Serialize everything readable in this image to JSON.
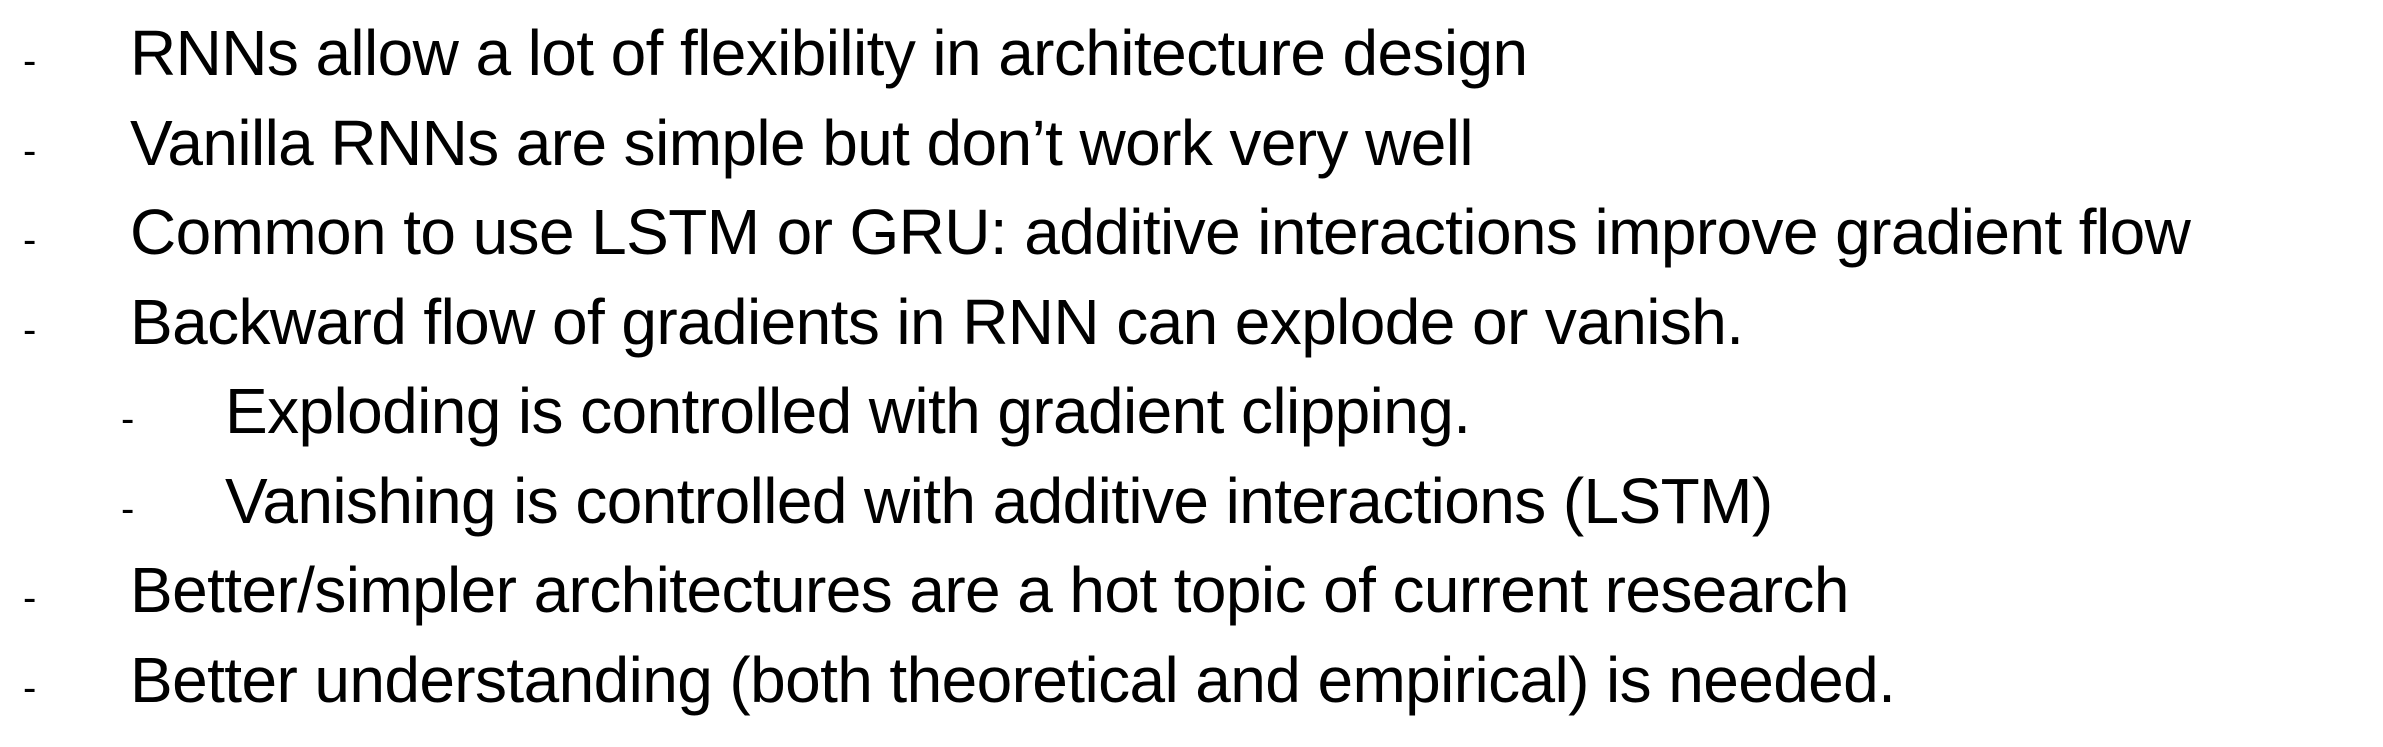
{
  "slide": {
    "bullets": [
      {
        "marker": "-",
        "level": 1,
        "text": "RNNs allow a lot of flexibility in architecture design"
      },
      {
        "marker": "-",
        "level": 1,
        "text": "Vanilla RNNs are simple but don’t work very well"
      },
      {
        "marker": "-",
        "level": 1,
        "text": "Common to use LSTM or GRU: additive interactions improve gradient flow"
      },
      {
        "marker": "-",
        "level": 1,
        "text": "Backward flow of gradients in RNN can explode or vanish."
      },
      {
        "marker": "-",
        "level": 2,
        "text": "Exploding is controlled with gradient clipping."
      },
      {
        "marker": "-",
        "level": 2,
        "text": "Vanishing is controlled with additive interactions (LSTM)"
      },
      {
        "marker": "-",
        "level": 1,
        "text": "Better/simpler architectures are a hot topic of current research"
      },
      {
        "marker": "-",
        "level": 1,
        "text": "Better understanding (both theoretical and empirical) is needed."
      }
    ]
  }
}
